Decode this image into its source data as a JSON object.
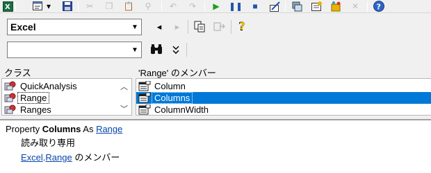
{
  "toolbar": {
    "icons": [
      "excel-icon",
      "view-menu-icon",
      "save-icon",
      "cut-icon",
      "copy-icon",
      "paste-icon",
      "find-icon",
      "undo-icon",
      "redo-icon",
      "run-icon",
      "pause-icon",
      "stop-icon",
      "design-icon",
      "project-explorer-icon",
      "properties-icon",
      "object-browser-icon",
      "toolbox-icon",
      "help-icon"
    ]
  },
  "library_combo": {
    "value": "Excel"
  },
  "search_combo": {
    "value": ""
  },
  "classes_pane": {
    "header": "クラス",
    "items": [
      {
        "label": "QuickAnalysis"
      },
      {
        "label": "Range"
      },
      {
        "label": "Ranges"
      }
    ]
  },
  "members_pane": {
    "header": "'Range' のメンバー",
    "items": [
      {
        "label": "Column"
      },
      {
        "label": "Columns"
      },
      {
        "label": "ColumnWidth"
      }
    ]
  },
  "details": {
    "prefix": "Property ",
    "member_name": "Columns",
    "as_text": " As ",
    "type_link": "Range",
    "readonly_text": "読み取り専用",
    "lib_link": "Excel",
    "dot": ".",
    "class_link": "Range",
    "member_of_text": " のメンバー"
  },
  "colors": {
    "selection": "#0078d7",
    "link": "#0645ad"
  }
}
